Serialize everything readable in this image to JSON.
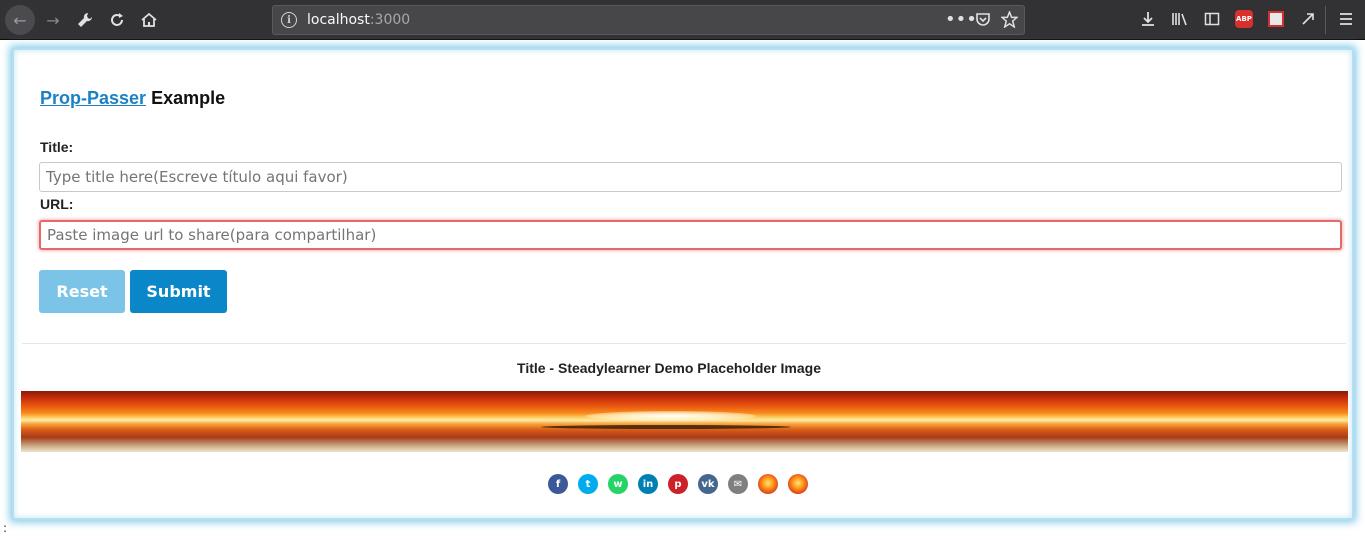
{
  "browser": {
    "url_host": "localhost",
    "url_port": ":3000",
    "icons": [
      "back-icon",
      "forward-icon",
      "wrench-icon",
      "reload-icon",
      "home-icon",
      "info-icon",
      "more-icon",
      "pocket-icon",
      "star-icon",
      "download-icon",
      "library-icon",
      "sidebar-icon",
      "adblock-icon",
      "extension-icon",
      "tool-icon",
      "menu-icon"
    ],
    "adblock_label": "ABP"
  },
  "page": {
    "heading_link": "Prop-Passer",
    "heading_rest": " Example",
    "title_label": "Title:",
    "title_placeholder": "Type title here(Escreve título aqui favor)",
    "url_label": "URL:",
    "url_placeholder": "Paste image url to share(para compartilhar)",
    "reset_label": "Reset",
    "submit_label": "Submit",
    "caption": "Title - Steadylearner Demo Placeholder Image",
    "share_buttons": [
      {
        "name": "facebook",
        "glyph": "f",
        "color": "#3b5998"
      },
      {
        "name": "twitter",
        "glyph": "t",
        "color": "#00aced"
      },
      {
        "name": "whatsapp",
        "glyph": "w",
        "color": "#25d366"
      },
      {
        "name": "linkedin",
        "glyph": "in",
        "color": "#007fb1"
      },
      {
        "name": "pinterest",
        "glyph": "p",
        "color": "#cb2128"
      },
      {
        "name": "vk",
        "glyph": "vk",
        "color": "#45668e"
      },
      {
        "name": "email",
        "glyph": "✉",
        "color": "#7f7f7f"
      },
      {
        "name": "image-share-1",
        "glyph": "",
        "color": "#f07818"
      },
      {
        "name": "image-share-2",
        "glyph": "",
        "color": "#f07818"
      }
    ],
    "bottom_mark": ":"
  }
}
